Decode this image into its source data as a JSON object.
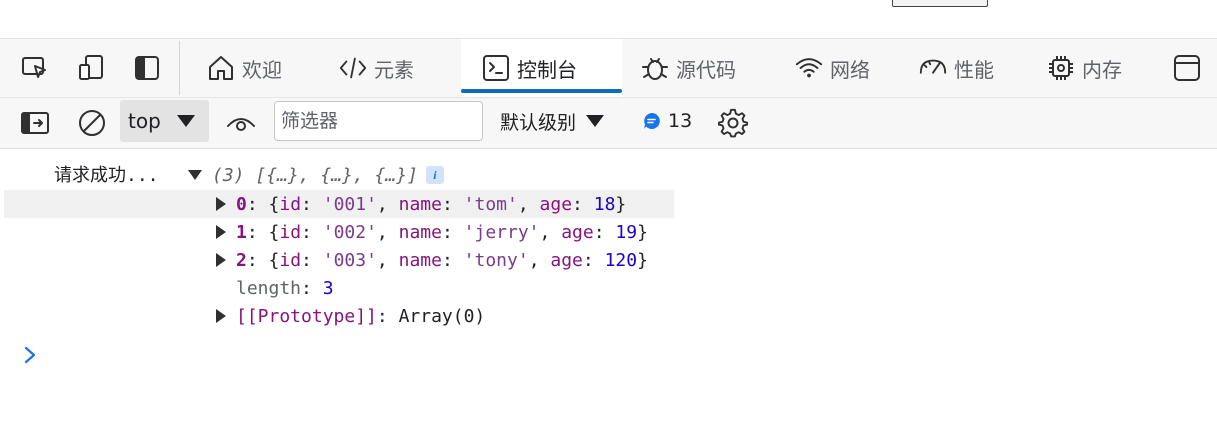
{
  "tabs": [
    {
      "label": "欢迎",
      "icon": "home-icon"
    },
    {
      "label": "元素",
      "icon": "code-icon"
    },
    {
      "label": "控制台",
      "icon": "console-icon"
    },
    {
      "label": "源代码",
      "icon": "bug-icon"
    },
    {
      "label": "网络",
      "icon": "wifi-icon"
    },
    {
      "label": "性能",
      "icon": "gauge-icon"
    },
    {
      "label": "内存",
      "icon": "chip-icon"
    }
  ],
  "active_tab": "控制台",
  "accent_color": "#0f6cbd",
  "toolbar": {
    "context": "top",
    "filter_placeholder": "筛选器",
    "levels": "默认级别",
    "message_count": "13"
  },
  "console": {
    "log_text": "请求成功...",
    "summary": "(3) [{…}, {…}, {…}]",
    "items": [
      {
        "index": "0",
        "id": "'001'",
        "name": "'tom'",
        "age": "18"
      },
      {
        "index": "1",
        "id": "'002'",
        "name": "'jerry'",
        "age": "19"
      },
      {
        "index": "2",
        "id": "'003'",
        "name": "'tony'",
        "age": "120"
      }
    ],
    "length_label": "length",
    "length_value": "3",
    "prototype_label": "[[Prototype]]",
    "prototype_value": "Array(0)"
  }
}
